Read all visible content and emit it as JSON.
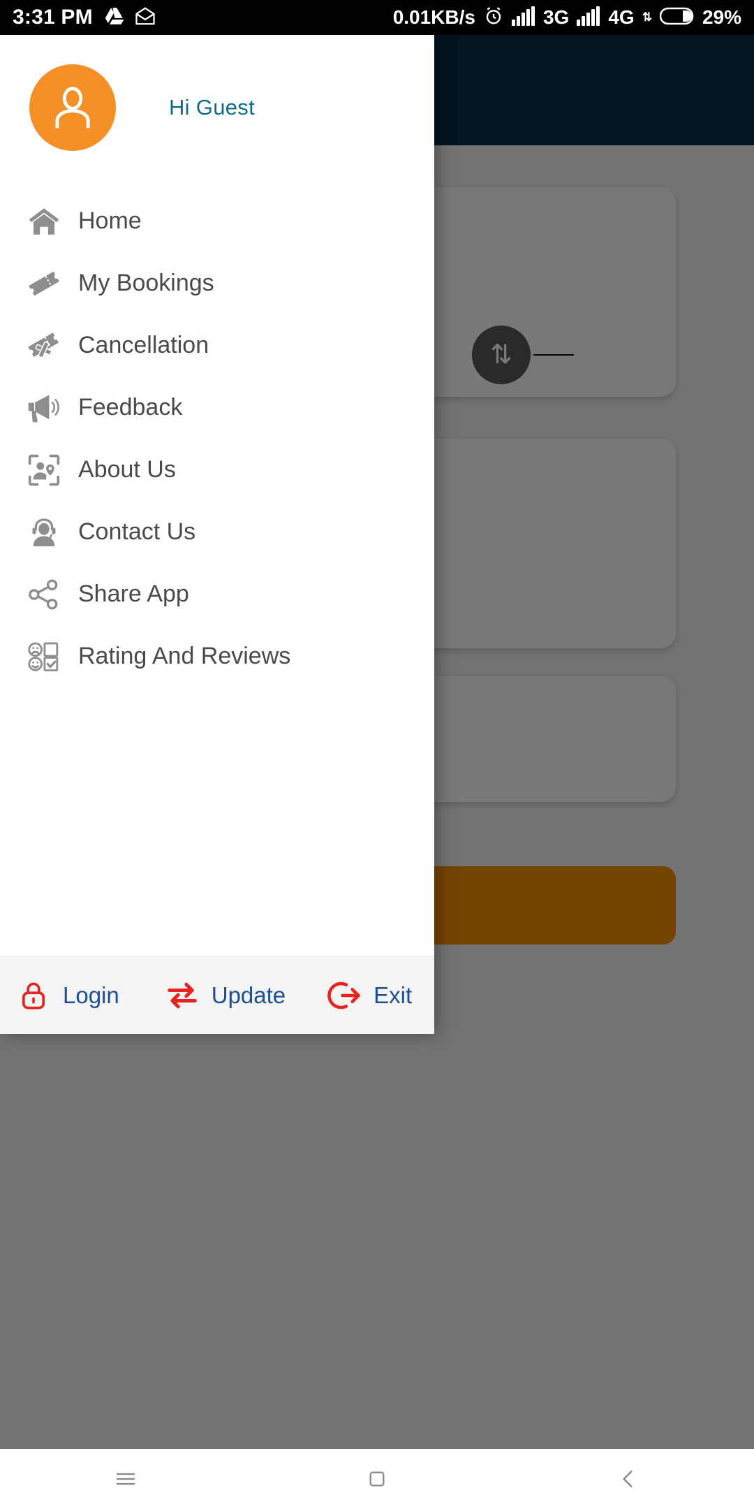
{
  "status_bar": {
    "time": "3:31 PM",
    "icons_left": [
      "drive-icon",
      "mail-open-icon"
    ],
    "net_speed": "0.01KB/s",
    "alarm_icon": "alarm-icon",
    "sim1_signal_icon": "signal-bars-icon",
    "sim1_network": "3G",
    "sim2_signal_icon": "signal-bars-icon",
    "sim2_network": "4G",
    "data_arrows_icon": "data-transfer-icon",
    "battery_icon": "battery-icon",
    "battery_level": "29%"
  },
  "drawer": {
    "avatar_icon": "user-avatar-icon",
    "greeting": "Hi Guest",
    "items": [
      {
        "label": "Home",
        "icon": "home-icon"
      },
      {
        "label": "My Bookings",
        "icon": "ticket-icon"
      },
      {
        "label": "Cancellation",
        "icon": "ticket-cancel-icon"
      },
      {
        "label": "Feedback",
        "icon": "megaphone-icon"
      },
      {
        "label": "About Us",
        "icon": "person-location-frame-icon"
      },
      {
        "label": "Contact Us",
        "icon": "headset-support-icon"
      },
      {
        "label": "Share App",
        "icon": "share-nodes-icon"
      },
      {
        "label": "Rating And Reviews",
        "icon": "rating-faces-checkbox-icon"
      }
    ],
    "footer": [
      {
        "label": "Login",
        "icon": "lock-icon"
      },
      {
        "label": "Update",
        "icon": "swap-arrows-icon"
      },
      {
        "label": "Exit",
        "icon": "logout-icon"
      }
    ]
  },
  "navigation_bar": {
    "recents_icon": "hamburger-icon",
    "home_icon": "square-icon",
    "back_icon": "chevron-left-icon"
  },
  "colors": {
    "avatar_orange": "#f49026",
    "greeting_teal": "#0f6a8c",
    "menu_icon_gray": "#8e8e8e",
    "menu_text_gray": "#4a4a4a",
    "footer_icon_red": "#e8221f",
    "footer_text_blue": "#1c4f93",
    "app_header_navy": "#062c44",
    "cta_orange": "#f28d00",
    "scrim": "rgba(0,0,0,0.52)"
  }
}
